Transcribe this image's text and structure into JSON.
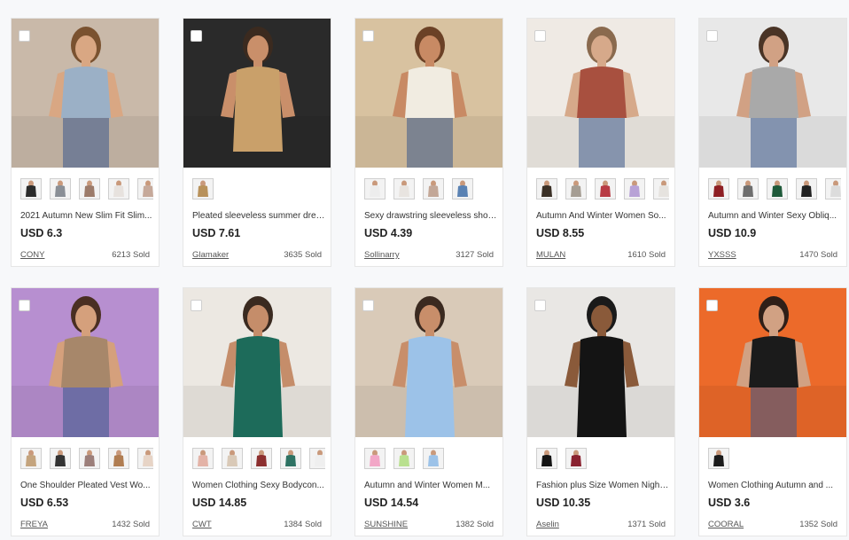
{
  "products": [
    {
      "title": "2021 Autumn New Slim Fit Slim...",
      "price": "USD 6.3",
      "store": "CONY",
      "sold": "6213 Sold",
      "bg": "#c9b9a9",
      "garment": "#9bb0c6",
      "skin": "#d9a783",
      "hair": "#7a5230",
      "swatches": [
        "#2b2b2b",
        "#8a8f96",
        "#9c7b6a",
        "#e7e2de",
        "#c6a99a"
      ]
    },
    {
      "title": "Pleated sleeveless summer dres...",
      "price": "USD 7.61",
      "store": "Glamaker",
      "sold": "3635 Sold",
      "bg": "#2a2a2a",
      "garment": "#c9a06a",
      "skin": "#c98f6a",
      "hair": "#3b2a1f",
      "swatches": [
        "#b8915a"
      ]
    },
    {
      "title": "Sexy drawstring sleeveless shor...",
      "price": "USD 4.39",
      "store": "Sollinarry",
      "sold": "3127 Sold",
      "bg": "#d8c2a0",
      "garment": "#f1ece1",
      "skin": "#c88a64",
      "hair": "#6b4126",
      "swatches": [
        "#ededed",
        "#e8e4e0",
        "#c3a797",
        "#5a82b3"
      ]
    },
    {
      "title": "Autumn And Winter Women So...",
      "price": "USD 8.55",
      "store": "MULAN",
      "sold": "1610 Sold",
      "bg": "#efeae4",
      "garment": "#a8503f",
      "skin": "#d6a98a",
      "hair": "#8a6a4e",
      "swatches": [
        "#3b3026",
        "#a59d93",
        "#b83b44",
        "#b8a2d6",
        "#e6e3df"
      ]
    },
    {
      "title": "Autumn and Winter Sexy Obliq...",
      "price": "USD 10.9",
      "store": "YXSSS",
      "sold": "1470 Sold",
      "bg": "#e8e8e8",
      "garment": "#a9a9a9",
      "skin": "#d1a184",
      "hair": "#4a3426",
      "swatches": [
        "#8e1f24",
        "#6e6e6e",
        "#1f5a3a",
        "#222222",
        "#dcdcdc"
      ]
    },
    {
      "title": "One Shoulder Pleated Vest Wo...",
      "price": "USD 6.53",
      "store": "FREYA",
      "sold": "1432 Sold",
      "bg": "#b78fd0",
      "garment": "#a7876a",
      "skin": "#d5a07c",
      "hair": "#4a2f22",
      "swatches": [
        "#c4a47e",
        "#333333",
        "#9c7f7a",
        "#b07d52",
        "#e7d4c6"
      ]
    },
    {
      "title": "Women Clothing Sexy Bodycon...",
      "price": "USD 14.85",
      "store": "CWT",
      "sold": "1384 Sold",
      "bg": "#ece8e2",
      "garment": "#1d6b5a",
      "skin": "#c58d6a",
      "hair": "#3a2a20",
      "swatches": [
        "#e3b3a7",
        "#d9c9b7",
        "#8c2f2f",
        "#2e7263",
        "#efefef"
      ]
    },
    {
      "title": "Autumn and Winter Women M...",
      "price": "USD 14.54",
      "store": "SUNSHINE",
      "sold": "1382 Sold",
      "bg": "#d9cab8",
      "garment": "#9cc2e8",
      "skin": "#c88e6a",
      "hair": "#3b2a20",
      "swatches": [
        "#f2a7c7",
        "#b9e08f",
        "#9cc2e8"
      ]
    },
    {
      "title": "Fashion plus Size Women Night...",
      "price": "USD 10.35",
      "store": "Aselin",
      "sold": "1371 Sold",
      "bg": "#e9e7e4",
      "garment": "#141414",
      "skin": "#8a5a3a",
      "hair": "#1a1a1a",
      "swatches": [
        "#141414",
        "#8a2230"
      ]
    },
    {
      "title": "Women Clothing Autumn and ...",
      "price": "USD 3.6",
      "store": "COORAL",
      "sold": "1352 Sold",
      "bg": "#ec6a2a",
      "garment": "#1b1b1b",
      "skin": "#d1a183",
      "hair": "#2f1f18",
      "swatches": [
        "#1b1b1b"
      ]
    }
  ]
}
